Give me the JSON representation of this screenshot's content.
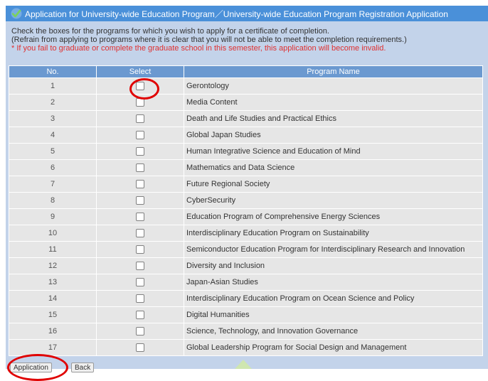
{
  "title": "Application for University-wide Education Program／University-wide Education Program Registration Application",
  "instructions": {
    "line1": "Check the boxes for the programs for which you wish to apply for a certificate of completion.",
    "line2": "(Refrain from applying to programs where it is clear that you will not be able to meet the completion requirements.)",
    "warning": "* If you fail to graduate or complete the graduate school in this semester, this application will become invalid."
  },
  "table": {
    "headers": {
      "no": "No.",
      "select": "Select",
      "name": "Program Name"
    },
    "rows": [
      {
        "no": "1",
        "name": "Gerontology"
      },
      {
        "no": "2",
        "name": "Media Content"
      },
      {
        "no": "3",
        "name": "Death and Life Studies and Practical Ethics"
      },
      {
        "no": "4",
        "name": "Global Japan Studies"
      },
      {
        "no": "5",
        "name": "Human Integrative Science and Education of Mind"
      },
      {
        "no": "6",
        "name": "Mathematics and Data Science"
      },
      {
        "no": "7",
        "name": "Future Regional Society"
      },
      {
        "no": "8",
        "name": "CyberSecurity"
      },
      {
        "no": "9",
        "name": "Education Program of Comprehensive Energy Sciences"
      },
      {
        "no": "10",
        "name": "Interdisciplinary Education Program on Sustainability"
      },
      {
        "no": "11",
        "name": "Semiconductor Education Program for Interdisciplinary Research and Innovation"
      },
      {
        "no": "12",
        "name": "Diversity and Inclusion"
      },
      {
        "no": "13",
        "name": "Japan-Asian Studies"
      },
      {
        "no": "14",
        "name": "Interdisciplinary Education Program on Ocean Science and Policy"
      },
      {
        "no": "15",
        "name": "Digital Humanities"
      },
      {
        "no": "16",
        "name": "Science, Technology, and Innovation Governance"
      },
      {
        "no": "17",
        "name": "Global Leadership Program for Social Design and Management"
      }
    ]
  },
  "buttons": {
    "apply": "Application",
    "back": "Back"
  },
  "icons": {
    "title": "checkmark-icon"
  },
  "colors": {
    "titlebar": "#4a90d9",
    "panel": "#c3d3ea",
    "header": "#6b99d0",
    "row": "#e6e6e6",
    "warning": "#e03030",
    "highlight": "#e00000"
  }
}
